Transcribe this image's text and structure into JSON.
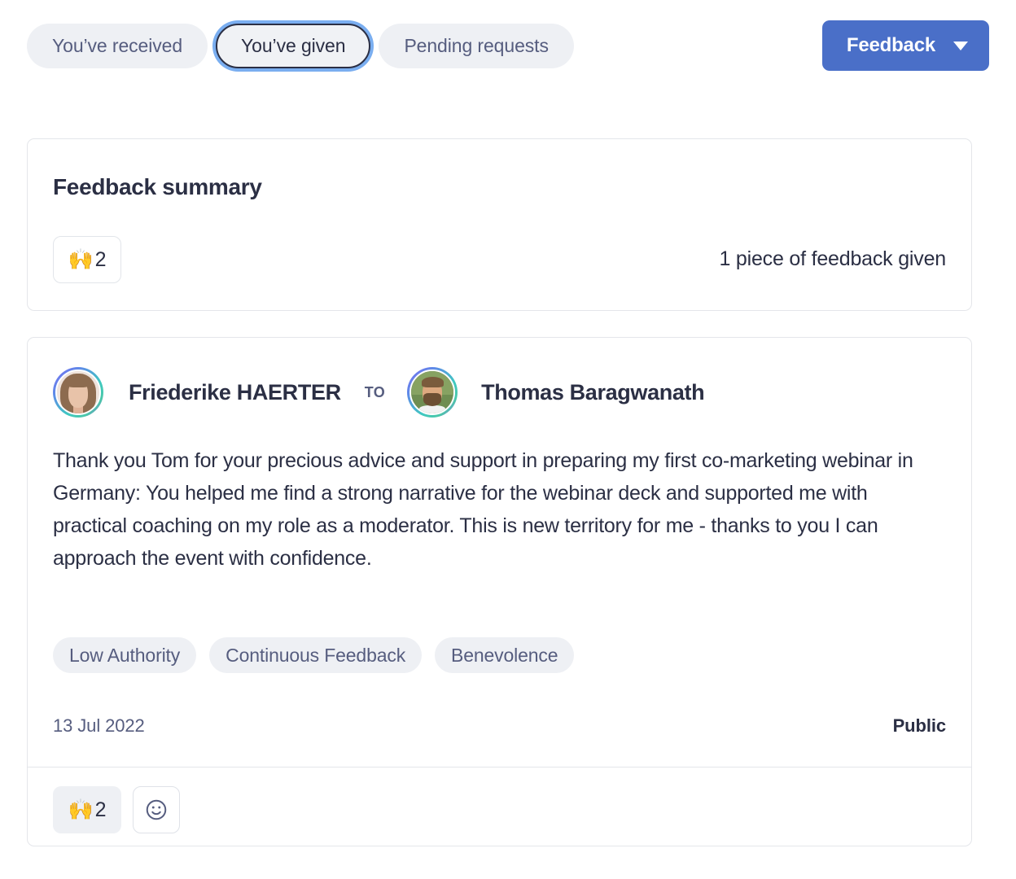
{
  "tabs": [
    {
      "label": "You’ve received",
      "selected": false,
      "name": "tab-youve-received"
    },
    {
      "label": "You’ve given",
      "selected": true,
      "name": "tab-youve-given"
    },
    {
      "label": "Pending requests",
      "selected": false,
      "name": "tab-pending-requests"
    }
  ],
  "primary_action": {
    "label": "Feedback",
    "caret": "chevron-down-icon",
    "color": "#4a6fc8"
  },
  "summary": {
    "title": "Feedback summary",
    "reaction": {
      "emoji": "🙌",
      "emoji_name": "raising-hands-emoji",
      "count": "2"
    },
    "count_text": "1 piece of feedback given"
  },
  "feedback": {
    "author": "Friederike HAERTER",
    "to_label": "TO",
    "recipient": "Thomas Baragwanath",
    "body": "Thank you Tom for your precious advice and support in preparing my first co-marketing webinar in Germany: You helped me find a strong narrative for the webinar deck and supported me with practical coaching on my role as a moderator. This is new territory for me - thanks to you I can approach the event with confidence.",
    "tags": [
      "Low Authority",
      "Continuous Feedback",
      "Benevolence"
    ],
    "date": "13 Jul 2022",
    "visibility": "Public",
    "reaction": {
      "emoji": "🙌",
      "emoji_name": "raising-hands-emoji",
      "count": "2"
    },
    "add_reaction_icon": "smiley-face-icon"
  },
  "colors": {
    "accent": "#4a6fc8",
    "text_primary": "#2b2f44",
    "text_muted": "#565d7f",
    "pill_bg": "#eef0f4",
    "card_border": "#e4e6ea",
    "focus_ring": "#7aaef0"
  }
}
